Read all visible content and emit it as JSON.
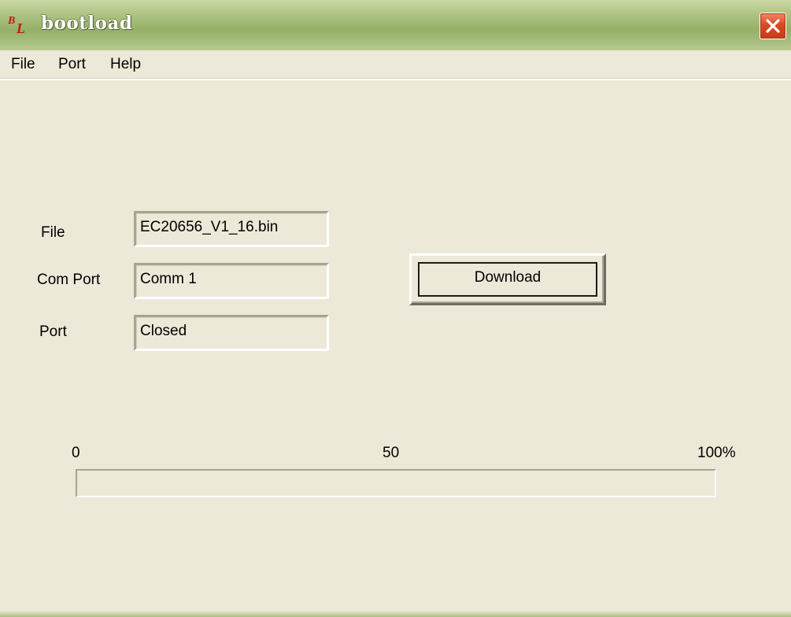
{
  "window": {
    "title": "bootload",
    "icon": "bl-app-icon",
    "icon_letters": [
      "B",
      "L"
    ],
    "close_icon": "close-x-icon"
  },
  "menu": {
    "items": [
      {
        "label": "File"
      },
      {
        "label": "Port"
      },
      {
        "label": "Help"
      }
    ]
  },
  "form": {
    "file_label": "File",
    "file_value": "EC20656_V1_16.bin",
    "com_port_label": "Com Port",
    "com_port_value": "Comm 1",
    "port_label": "Port",
    "port_value": "Closed"
  },
  "actions": {
    "download_label": "Download"
  },
  "progress": {
    "tick_0": "0",
    "tick_50": "50",
    "tick_100": "100%",
    "value_percent": 0
  },
  "colors": {
    "window_bg": "#ece9d8",
    "title_accent": "#96b067",
    "close_red": "#d84a26",
    "progress_fill": "#316ac5"
  }
}
